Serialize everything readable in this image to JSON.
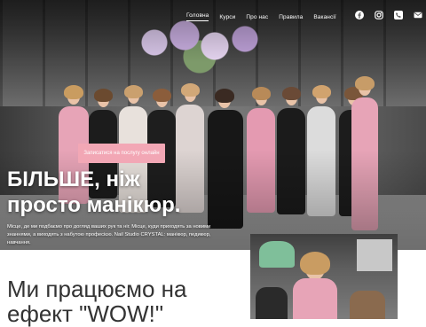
{
  "nav": {
    "items": [
      {
        "label": "Головна",
        "active": true
      },
      {
        "label": "Курси",
        "active": false
      },
      {
        "label": "Про нас",
        "active": false
      },
      {
        "label": "Правила",
        "active": false
      },
      {
        "label": "Вакансії",
        "active": false
      }
    ]
  },
  "socials": [
    "facebook-icon",
    "instagram-icon",
    "phone-icon",
    "mail-icon"
  ],
  "hero": {
    "cta_label": "Записатися на послугу онлайн",
    "title_line1": "БІЛЬШЕ, ніж",
    "title_line2": "просто манікюр.",
    "lead": "Місце, де ми подбаємо про догляд ваших рук та ніг. Місце, куди приходять за новими знаннями, а виходять з набутою професією. Nail Studio CRYSTAL: манікюр, педикюр, навчання."
  },
  "section": {
    "title_line1": "Ми працюємо на",
    "title_line2": "ефект \"WOW!\""
  },
  "colors": {
    "accent": "#f2a7b5",
    "text_dark": "#333333",
    "white": "#ffffff"
  }
}
